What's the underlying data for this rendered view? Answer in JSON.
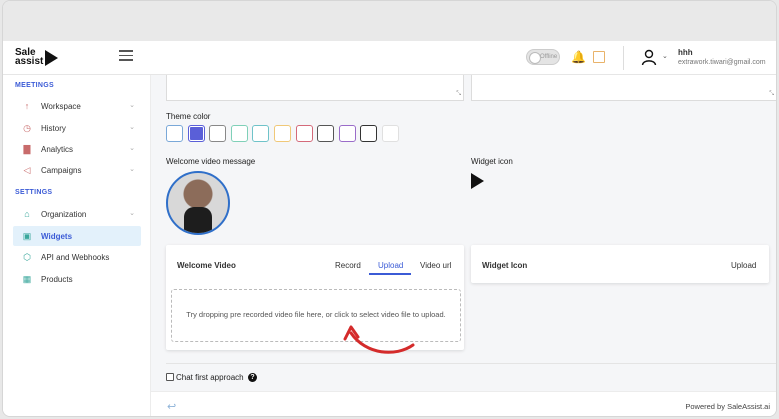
{
  "header": {
    "logo_line1": "Sale",
    "logo_line2": "assist",
    "status_toggle": "Offline",
    "user_name": "hhh",
    "user_email": "extrawork.tiwari@gmail.com"
  },
  "sidebar": {
    "meetings_title": "MEETINGS",
    "settings_title": "SETTINGS",
    "meetings_items": [
      {
        "label": "Workspace",
        "icon": "rocket-icon"
      },
      {
        "label": "History",
        "icon": "clock-icon"
      },
      {
        "label": "Analytics",
        "icon": "chart-icon"
      },
      {
        "label": "Campaigns",
        "icon": "megaphone-icon"
      }
    ],
    "settings_items": [
      {
        "label": "Organization",
        "icon": "building-icon"
      },
      {
        "label": "Widgets",
        "icon": "widget-icon"
      },
      {
        "label": "API and Webhooks",
        "icon": "api-icon"
      },
      {
        "label": "Products",
        "icon": "products-icon"
      }
    ]
  },
  "main": {
    "theme_color_label": "Theme color",
    "theme_colors": [
      "#ffffff",
      "#5a5fd8",
      "#ffffff",
      "#ffffff",
      "#ffffff",
      "#ffffff",
      "#ffffff",
      "#ffffff",
      "#ffffff",
      "#ffffff",
      "#ffffff"
    ],
    "theme_color_borders": [
      "#7aa8d8",
      "#5a5fd8",
      "#888888",
      "#7fd0b8",
      "#6fc3c9",
      "#f0c878",
      "#d46a7a",
      "#555555",
      "#9a6cc9",
      "#333333",
      "#e0e0e0"
    ],
    "selected_theme_index": 1,
    "welcome_video_message_label": "Welcome video message",
    "widget_icon_label": "Widget icon",
    "welcome_video_card_title": "Welcome Video",
    "video_tabs": [
      "Record",
      "Upload",
      "Video url"
    ],
    "active_video_tab": "Upload",
    "dropzone_text": "Try dropping pre recorded video file here, or click to select video file to upload.",
    "widget_icon_card_title": "Widget Icon",
    "widget_icon_upload": "Upload",
    "chat_first_label": "Chat first approach",
    "help_mark": "?"
  },
  "footer": {
    "powered_by": "Powered by SaleAssist.ai"
  },
  "colors": {
    "accent": "#3b5bd6",
    "active_bg": "#e3f1fb",
    "annotation_arrow": "#d42b2b"
  }
}
